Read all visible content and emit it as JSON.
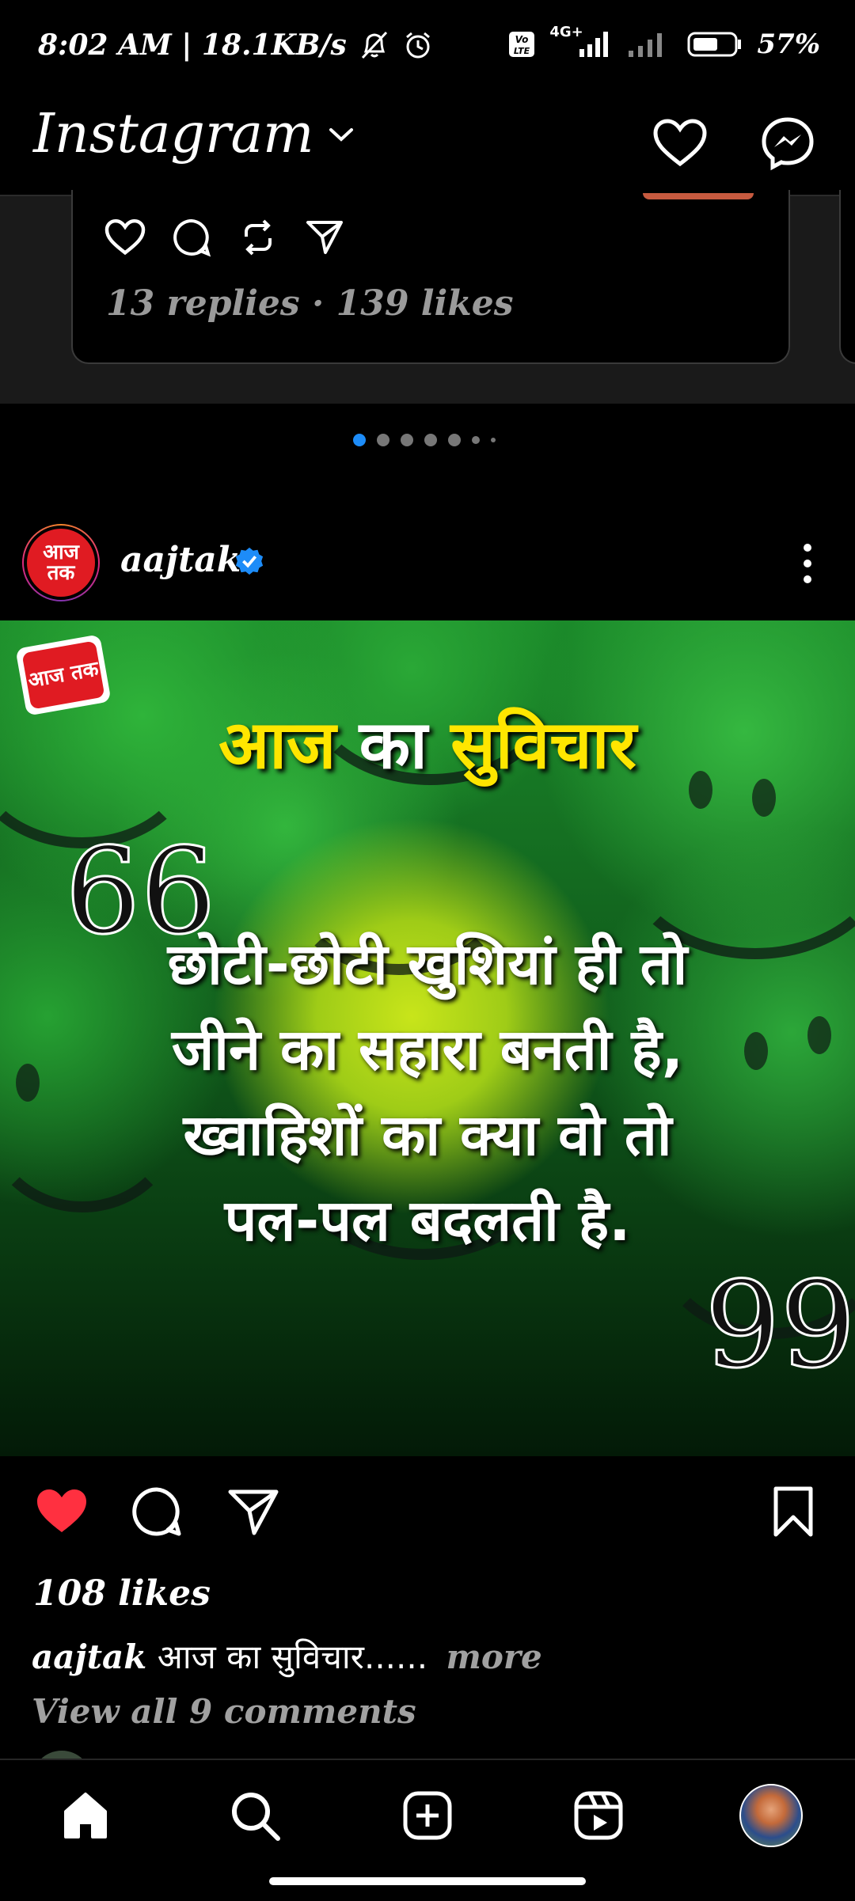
{
  "status_bar": {
    "time_speed": "8:02 AM | 18.1KB/s",
    "network": "4G+",
    "battery": "57%"
  },
  "header": {
    "app_name": "Instagram"
  },
  "thread_card": {
    "stats": "13 replies · 139 likes"
  },
  "carousel": {
    "dots": 7,
    "active": 0
  },
  "post": {
    "username": "aajtak",
    "avatar_text": "आज तक",
    "image": {
      "badge_text": "आज तक",
      "title_yellow_1": "आज",
      "title_white": "का",
      "title_yellow_2": "सुविचार",
      "open_quote": "66",
      "close_quote": "99",
      "lines": [
        "छोटी-छोटी खुशियां ही तो",
        "जीने का सहारा बनती है,",
        "ख्वाहिशों का क्या वो तो",
        "पल-पल बदलती है."
      ]
    },
    "likes": "108 likes",
    "caption_user": "aajtak",
    "caption_text": "आज का सुविचार......",
    "more_label": "more",
    "comments_link": "View all 9 comments",
    "liked": true
  },
  "colors": {
    "like_red": "#ff3040",
    "active_dot": "#1d8cf8",
    "title_yellow": "#ffe600"
  },
  "nav": [
    "home-icon",
    "search-icon",
    "create-icon",
    "reels-icon",
    "profile-avatar"
  ]
}
